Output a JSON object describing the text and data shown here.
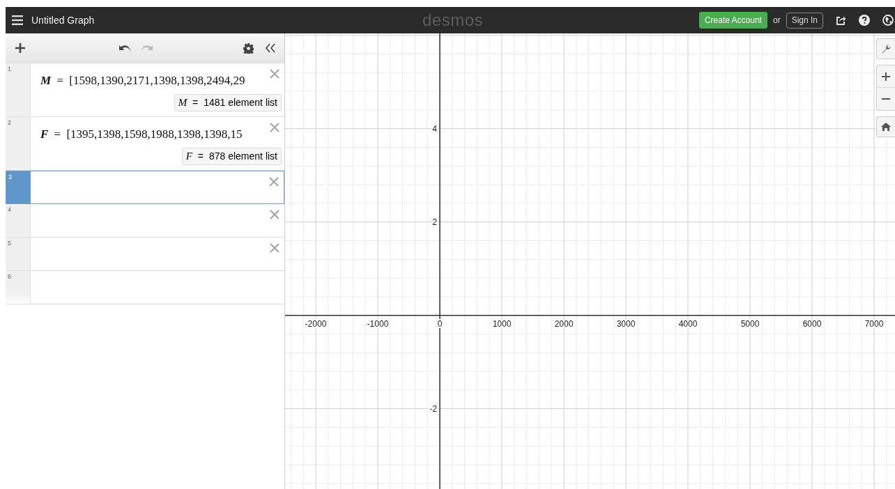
{
  "header": {
    "title": "Untitled Graph",
    "logo": "desmos",
    "create_account": "Create Account",
    "or": "or",
    "sign_in": "Sign In"
  },
  "expressions": [
    {
      "number": "1",
      "kind": "list",
      "selected": false,
      "variable": "M",
      "equals": "=",
      "value": "[1598,1390,2171,1398,1398,2494,29",
      "result": {
        "variable": "M",
        "equals": "=",
        "text": "1481 element list"
      }
    },
    {
      "number": "2",
      "kind": "list",
      "selected": false,
      "variable": "F",
      "equals": "=",
      "value": "[1395,1398,1598,1988,1398,1398,15",
      "result": {
        "variable": "F",
        "equals": "=",
        "text": "878 element list"
      }
    },
    {
      "number": "3",
      "kind": "empty",
      "selected": true
    },
    {
      "number": "4",
      "kind": "empty",
      "selected": false
    },
    {
      "number": "5",
      "kind": "empty",
      "selected": false
    },
    {
      "number": "6",
      "kind": "new",
      "selected": false
    }
  ],
  "graph": {
    "chart_data": {
      "type": "line",
      "grid": true,
      "xlim": [
        -2494,
        7348
      ],
      "ylim": [
        -3.72,
        6.04
      ],
      "xticks": [
        {
          "value": -2000,
          "label": "-2000"
        },
        {
          "value": -1000,
          "label": "-1000"
        },
        {
          "value": 0,
          "label": "0"
        },
        {
          "value": 1000,
          "label": "1000"
        },
        {
          "value": 2000,
          "label": "2000"
        },
        {
          "value": 3000,
          "label": "3000"
        },
        {
          "value": 4000,
          "label": "4000"
        },
        {
          "value": 5000,
          "label": "5000"
        },
        {
          "value": 6000,
          "label": "6000"
        },
        {
          "value": 7000,
          "label": "7000"
        }
      ],
      "yticks": [
        {
          "value": 4,
          "label": "4"
        },
        {
          "value": 2,
          "label": "2"
        },
        {
          "value": -2,
          "label": "-2"
        }
      ]
    }
  }
}
